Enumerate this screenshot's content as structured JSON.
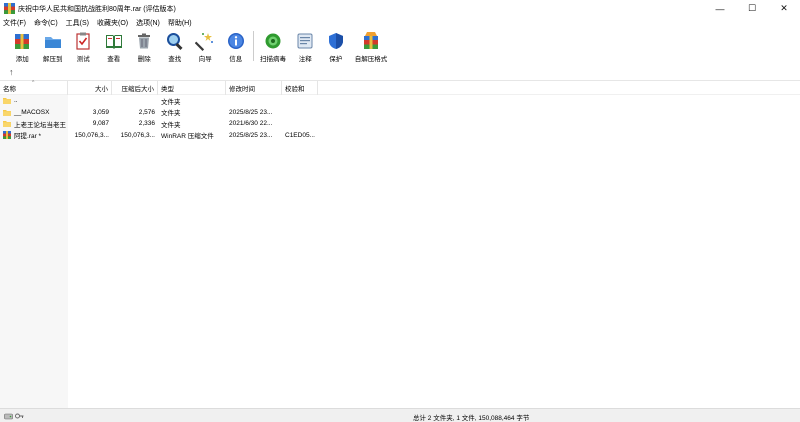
{
  "window": {
    "title": "庆祝中华人民共和国抗战胜利80周年.rar (评估版本)",
    "minimize": "—",
    "maximize": "☐",
    "close": "✕"
  },
  "menu": [
    "文件(F)",
    "命令(C)",
    "工具(S)",
    "收藏夹(O)",
    "选项(N)",
    "帮助(H)"
  ],
  "toolbar": [
    {
      "label": "添加",
      "icon": "add-archive-icon"
    },
    {
      "label": "解压到",
      "icon": "extract-folder-icon"
    },
    {
      "label": "测试",
      "icon": "test-clipboard-icon"
    },
    {
      "label": "查看",
      "icon": "view-book-icon"
    },
    {
      "label": "删除",
      "icon": "trash-icon"
    },
    {
      "label": "查找",
      "icon": "magnifier-icon"
    },
    {
      "label": "向导",
      "icon": "wizard-wand-icon"
    },
    {
      "label": "信息",
      "icon": "info-icon"
    },
    {
      "label": "扫描病毒",
      "icon": "virus-scan-icon"
    },
    {
      "label": "注释",
      "icon": "comment-icon"
    },
    {
      "label": "保护",
      "icon": "shield-icon"
    },
    {
      "label": "自解压格式",
      "icon": "sfx-icon"
    }
  ],
  "pathbar": {
    "up": "↑"
  },
  "columns": [
    "名称",
    "大小",
    "压缩后大小",
    "类型",
    "修改时间",
    "校验和"
  ],
  "sort_indicator": "^",
  "rows": [
    {
      "name": "..",
      "size": "",
      "packed": "",
      "type": "文件夹",
      "modified": "",
      "crc": "",
      "icon": "folder-icon"
    },
    {
      "name": "__MACOSX",
      "size": "3,059",
      "packed": "2,576",
      "type": "文件夹",
      "modified": "2025/8/25 23...",
      "crc": "",
      "icon": "folder-icon"
    },
    {
      "name": "上老王论坛当老王",
      "size": "9,087",
      "packed": "2,336",
      "type": "文件夹",
      "modified": "2021/6/30 22...",
      "crc": "",
      "icon": "folder-icon"
    },
    {
      "name": "阿提.rar *",
      "size": "150,076,3...",
      "packed": "150,076,3...",
      "type": "WinRAR 压缩文件",
      "modified": "2025/8/25 23...",
      "crc": "C1ED05...",
      "icon": "rar-file-icon"
    }
  ],
  "status": {
    "summary": "总计 2 文件夹, 1 文件, 150,088,464 字节"
  },
  "colors": {
    "folder": "#f7c948",
    "namecol_bg": "#f7f7f7",
    "statusbar_bg": "#f0f0f0"
  }
}
